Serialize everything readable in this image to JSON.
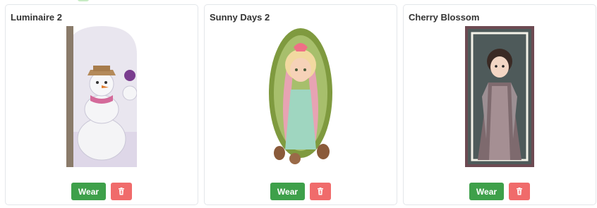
{
  "outfits": [
    {
      "title": "Luminaire 2",
      "wear_label": "Wear",
      "delete_icon": "trash-icon"
    },
    {
      "title": "Sunny Days 2",
      "wear_label": "Wear",
      "delete_icon": "trash-icon"
    },
    {
      "title": "Cherry Blossom",
      "wear_label": "Wear",
      "delete_icon": "trash-icon"
    }
  ],
  "colors": {
    "wear": "#3ea04a",
    "delete": "#f06b6b",
    "border": "#e3e6ea"
  }
}
